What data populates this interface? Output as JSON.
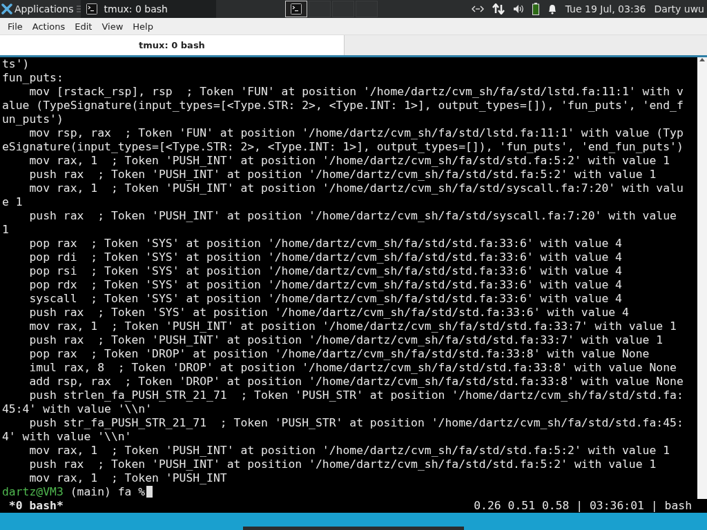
{
  "top_panel": {
    "applications_label": "Applications",
    "tasks": [
      {
        "title": "tmux: 0 bash",
        "selected": true
      }
    ],
    "workspaces": [
      {
        "selected": true
      },
      {
        "selected": false
      },
      {
        "selected": false
      },
      {
        "selected": false
      }
    ],
    "clock": "Tue 19 Jul, 03:36",
    "user": "Darty uwu"
  },
  "menu_bar": [
    "File",
    "Actions",
    "Edit",
    "View",
    "Help"
  ],
  "tabs": [
    {
      "label": "tmux: 0 bash",
      "selected": true
    }
  ],
  "terminal": {
    "lines": [
      "ts')",
      "fun_puts:",
      "    mov [rstack_rsp], rsp  ; Token 'FUN' at position '/home/dartz/cvm_sh/fa/std/lstd.fa:11:1' with v",
      "alue (TypeSignature(input_types=[<Type.STR: 2>, <Type.INT: 1>], output_types=[]), 'fun_puts', 'end_f",
      "un_puts')",
      "    mov rsp, rax  ; Token 'FUN' at position '/home/dartz/cvm_sh/fa/std/lstd.fa:11:1' with value (Typ",
      "eSignature(input_types=[<Type.STR: 2>, <Type.INT: 1>], output_types=[]), 'fun_puts', 'end_fun_puts')",
      "    mov rax, 1  ; Token 'PUSH_INT' at position '/home/dartz/cvm_sh/fa/std/std.fa:5:2' with value 1",
      "    push rax  ; Token 'PUSH_INT' at position '/home/dartz/cvm_sh/fa/std/std.fa:5:2' with value 1",
      "    mov rax, 1  ; Token 'PUSH_INT' at position '/home/dartz/cvm_sh/fa/std/syscall.fa:7:20' with valu",
      "e 1",
      "    push rax  ; Token 'PUSH_INT' at position '/home/dartz/cvm_sh/fa/std/syscall.fa:7:20' with value",
      "1",
      "    pop rax  ; Token 'SYS' at position '/home/dartz/cvm_sh/fa/std/std.fa:33:6' with value 4",
      "    pop rdi  ; Token 'SYS' at position '/home/dartz/cvm_sh/fa/std/std.fa:33:6' with value 4",
      "    pop rsi  ; Token 'SYS' at position '/home/dartz/cvm_sh/fa/std/std.fa:33:6' with value 4",
      "    pop rdx  ; Token 'SYS' at position '/home/dartz/cvm_sh/fa/std/std.fa:33:6' with value 4",
      "    syscall  ; Token 'SYS' at position '/home/dartz/cvm_sh/fa/std/std.fa:33:6' with value 4",
      "    push rax  ; Token 'SYS' at position '/home/dartz/cvm_sh/fa/std/std.fa:33:6' with value 4",
      "    mov rax, 1  ; Token 'PUSH_INT' at position '/home/dartz/cvm_sh/fa/std/std.fa:33:7' with value 1",
      "    push rax  ; Token 'PUSH_INT' at position '/home/dartz/cvm_sh/fa/std/std.fa:33:7' with value 1",
      "    pop rax  ; Token 'DROP' at position '/home/dartz/cvm_sh/fa/std/std.fa:33:8' with value None",
      "    imul rax, 8  ; Token 'DROP' at position '/home/dartz/cvm_sh/fa/std/std.fa:33:8' with value None",
      "    add rsp, rax  ; Token 'DROP' at position '/home/dartz/cvm_sh/fa/std/std.fa:33:8' with value None",
      "    push strlen_fa_PUSH_STR_21_71  ; Token 'PUSH_STR' at position '/home/dartz/cvm_sh/fa/std/std.fa:",
      "45:4' with value '\\\\n'",
      "    push str_fa_PUSH_STR_21_71  ; Token 'PUSH_STR' at position '/home/dartz/cvm_sh/fa/std/std.fa:45:",
      "4' with value '\\\\n'",
      "    mov rax, 1  ; Token 'PUSH_INT' at position '/home/dartz/cvm_sh/fa/std/std.fa:5:2' with value 1",
      "    push rax  ; Token 'PUSH_INT' at position '/home/dartz/cvm_sh/fa/std/std.fa:5:2' with value 1",
      "    mov rax, 1  ; Token 'PUSH_INT"
    ],
    "prompt": {
      "user_host": "dartz@VM3",
      "rest": " (main) fa %"
    },
    "status_left": " *0 bash*",
    "status_right": "0.26 0.51 0.58 | 03:36:01 | bash"
  }
}
